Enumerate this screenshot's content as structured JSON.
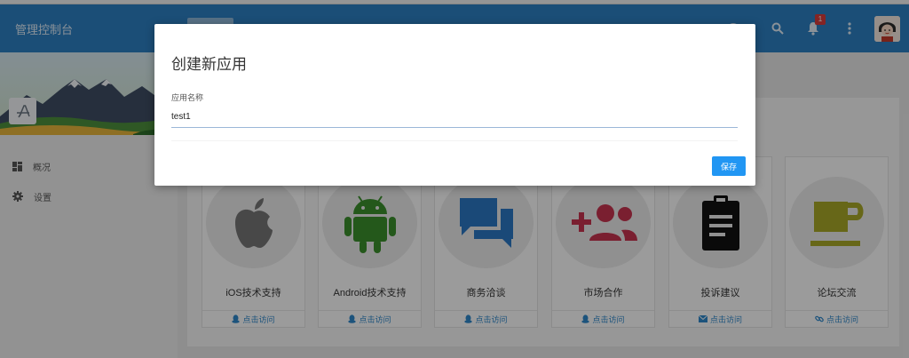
{
  "header": {
    "title": "管理控制台",
    "notification_count": "1"
  },
  "sidebar": {
    "items": [
      {
        "label": "概况",
        "icon": "dashboard-icon"
      },
      {
        "label": "设置",
        "icon": "gear-icon"
      }
    ]
  },
  "cards": [
    {
      "title": "iOS技术支持",
      "icon": "apple-icon",
      "link": "点击访问",
      "link_icon": "qq-icon"
    },
    {
      "title": "Android技术支持",
      "icon": "android-icon",
      "link": "点击访问",
      "link_icon": "qq-icon"
    },
    {
      "title": "商务洽谈",
      "icon": "chat-bubbles-icon",
      "link": "点击访问",
      "link_icon": "qq-icon"
    },
    {
      "title": "市场合作",
      "icon": "add-group-icon",
      "link": "点击访问",
      "link_icon": "qq-icon"
    },
    {
      "title": "投诉建议",
      "icon": "clipboard-icon",
      "link": "点击访问",
      "link_icon": "mail-icon"
    },
    {
      "title": "论坛交流",
      "icon": "coffee-icon",
      "link": "点击访问",
      "link_icon": "link-icon"
    }
  ],
  "dialog": {
    "title": "创建新应用",
    "field_label": "应用名称",
    "field_value": "test1",
    "save_label": "保存"
  },
  "colors": {
    "header": "#2c7fc0",
    "primary_button": "#2196f3",
    "badge": "#d63b3b",
    "android_green": "#3a8f2c",
    "chat_blue": "#2a77c2",
    "market_red": "#c5334e",
    "coffee_olive": "#a6a628"
  }
}
